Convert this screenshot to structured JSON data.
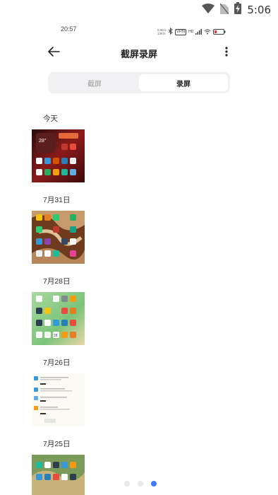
{
  "system_status": {
    "time": "5:06"
  },
  "inner_status": {
    "time": "20:57",
    "speed_up": "0.6K/s",
    "speed_down": "13K/s",
    "vpn": "VPN",
    "hd": "HD"
  },
  "header": {
    "title": "截屏录屏",
    "back_icon": "arrow-left-icon",
    "more_icon": "more-vert-icon"
  },
  "tabs": [
    {
      "label": "截屏",
      "active": false
    },
    {
      "label": "录屏",
      "active": true
    }
  ],
  "groups": [
    {
      "date": "今天"
    },
    {
      "date": "7月31日"
    },
    {
      "date": "7月28日"
    },
    {
      "date": "7月26日"
    },
    {
      "date": "7月25日"
    }
  ],
  "thumb_texts": {
    "weather_temp": "28°",
    "calendar_day": "28"
  },
  "page_indicator": {
    "count": 3,
    "active_index": 2
  },
  "colors": {
    "accent": "#3b7ef2",
    "tab_bg": "#f1f1f3",
    "text": "#222222"
  }
}
